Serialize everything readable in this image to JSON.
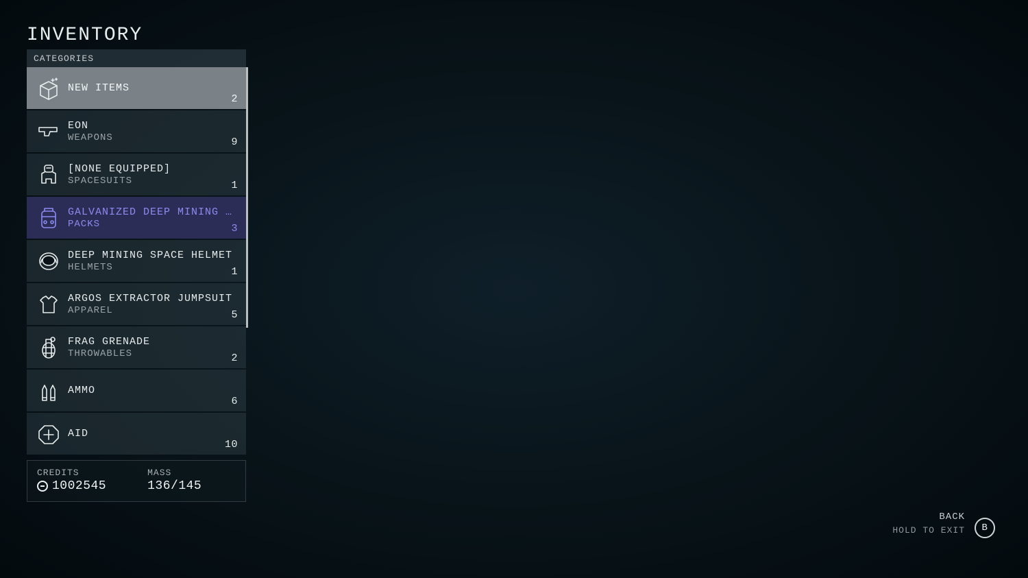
{
  "title": "INVENTORY",
  "categories_header": "CATEGORIES",
  "categories": [
    {
      "icon": "box-sparkle-icon",
      "primary": "NEW ITEMS",
      "secondary": "",
      "count": "2",
      "state": "selected"
    },
    {
      "icon": "pistol-icon",
      "primary": "EON",
      "secondary": "WEAPONS",
      "count": "9",
      "state": ""
    },
    {
      "icon": "spacesuit-icon",
      "primary": "[NONE EQUIPPED]",
      "secondary": "SPACESUITS",
      "count": "1",
      "state": ""
    },
    {
      "icon": "pack-icon",
      "primary": "GALVANIZED DEEP MINING …",
      "secondary": "PACKS",
      "count": "3",
      "state": "highlighted"
    },
    {
      "icon": "helmet-icon",
      "primary": "DEEP MINING SPACE HELMET",
      "secondary": "HELMETS",
      "count": "1",
      "state": ""
    },
    {
      "icon": "shirt-icon",
      "primary": "ARGOS EXTRACTOR JUMPSUIT",
      "secondary": "APPAREL",
      "count": "5",
      "state": ""
    },
    {
      "icon": "grenade-icon",
      "primary": "FRAG GRENADE",
      "secondary": "THROWABLES",
      "count": "2",
      "state": ""
    },
    {
      "icon": "ammo-icon",
      "primary": "AMMO",
      "secondary": "",
      "count": "6",
      "state": ""
    },
    {
      "icon": "aid-icon",
      "primary": "AID",
      "secondary": "",
      "count": "10",
      "state": ""
    }
  ],
  "stats": {
    "credits_label": "CREDITS",
    "credits_value": "1002545",
    "mass_label": "MASS",
    "mass_value": "136/145"
  },
  "footer": {
    "back": "BACK",
    "hold": "HOLD TO EXIT",
    "button": "B"
  }
}
